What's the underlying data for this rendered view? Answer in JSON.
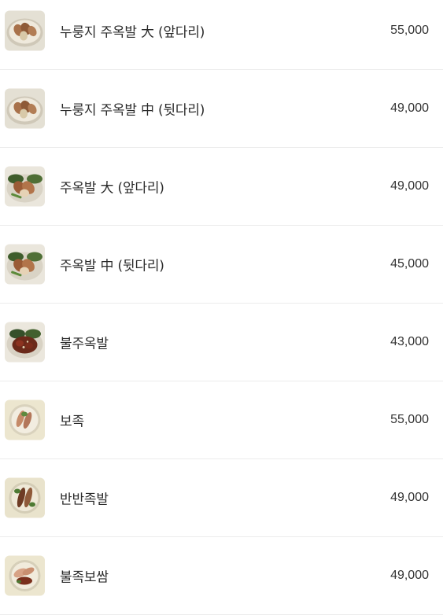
{
  "menu": {
    "items": [
      {
        "name": "누룽지 주옥발 大 (앞다리)",
        "price": "55,000",
        "thumb": "nurungji-jokbal-photo"
      },
      {
        "name": "누룽지 주옥발 中 (뒷다리)",
        "price": "49,000",
        "thumb": "nurungji-jokbal-photo"
      },
      {
        "name": "주옥발 大 (앞다리)",
        "price": "49,000",
        "thumb": "jokbal-photo"
      },
      {
        "name": "주옥발 中 (뒷다리)",
        "price": "45,000",
        "thumb": "jokbal-photo"
      },
      {
        "name": "불주옥발",
        "price": "43,000",
        "thumb": "spicy-jokbal-photo"
      },
      {
        "name": "보족",
        "price": "55,000",
        "thumb": "bojok-photo"
      },
      {
        "name": "반반족발",
        "price": "49,000",
        "thumb": "banban-jokbal-photo"
      },
      {
        "name": "불족보쌈",
        "price": "49,000",
        "thumb": "spicy-bossam-photo"
      }
    ]
  }
}
